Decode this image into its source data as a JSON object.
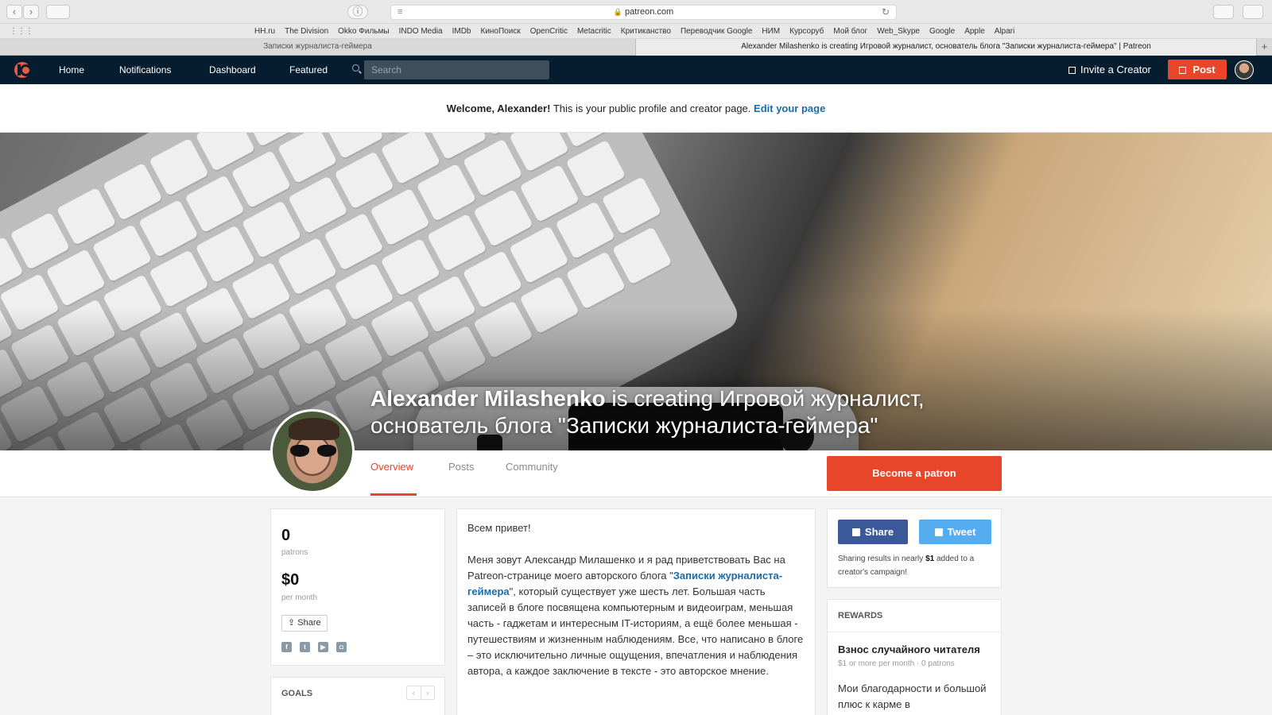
{
  "browser": {
    "url": "patreon.com",
    "bookmarks": [
      "HH.ru",
      "The Division",
      "Okko Фильмы",
      "INDO Media",
      "IMDb",
      "КиноПоиск",
      "OpenCritic",
      "Metacritic",
      "Критиканство",
      "Переводчик Google",
      "НИМ",
      "Курсоруб",
      "Мой блог",
      "Web_Skype",
      "Google",
      "Apple",
      "Alpari"
    ],
    "tabs": [
      {
        "title": "Записки журналиста-геймера"
      },
      {
        "title": "Alexander Milashenko is creating Игровой журналист, основатель блога \"Записки журналиста-геймера\" | Patreon"
      }
    ]
  },
  "nav": {
    "items": [
      "Home",
      "Notifications",
      "Dashboard",
      "Featured"
    ],
    "search_placeholder": "Search",
    "invite": "Invite a Creator",
    "post": "Post"
  },
  "welcome": {
    "greeting": "Welcome, Alexander!",
    "text": "This is your public profile and creator page.",
    "link": "Edit your page"
  },
  "cover": {
    "name": "Alexander Milashenko",
    "creating": " is creating Игровой журналист, основатель блога \"Записки журналиста-геймера\""
  },
  "profile_tabs": [
    "Overview",
    "Posts",
    "Community"
  ],
  "become_patron": "Become a patron",
  "stats": {
    "patrons_count": "0",
    "patrons_label": "patrons",
    "amount": "$0",
    "amount_label": "per month",
    "share": "Share",
    "social_icons": [
      "facebook-icon",
      "twitter-icon",
      "youtube-icon",
      "twitch-icon"
    ]
  },
  "goals": {
    "title": "GOALS"
  },
  "about": {
    "greeting": "Всем привет!",
    "p1_before": "Меня зовут Александр Милашенко и я рад приветствовать Вас на Patreon-странице моего авторского блога \"",
    "p1_link": "Записки журналиста-геймера",
    "p1_after": "\", который существует уже шесть лет. Большая часть записей в блоге посвящена компьютерным и видеоиграм, меньшая часть - гаджетам и интересным IT-историям, а ещё более меньшая - путешествиям и жизненным наблюдениям. Все, что написано в блоге – это исключительно личные ощущения, впечатления и наблюдения автора, а каждое заключение в тексте - это авторское мнение."
  },
  "share_card": {
    "facebook": "Share",
    "twitter": "Tweet",
    "note_before": "Sharing results in nearly",
    "note_amount": "$1",
    "note_after": "added to a creator's campaign!"
  },
  "rewards": {
    "title": "REWARDS",
    "items": [
      {
        "name": "Взнос случайного читателя",
        "meta": "$1 or more per month · 0 patrons",
        "description": "Мои благодарности и большой плюс к карме в"
      }
    ]
  },
  "colors": {
    "brand": "#e8462b",
    "nav_bg": "#051d2f",
    "link": "#1a6ca8",
    "facebook": "#3b5998",
    "twitter": "#55acee"
  }
}
